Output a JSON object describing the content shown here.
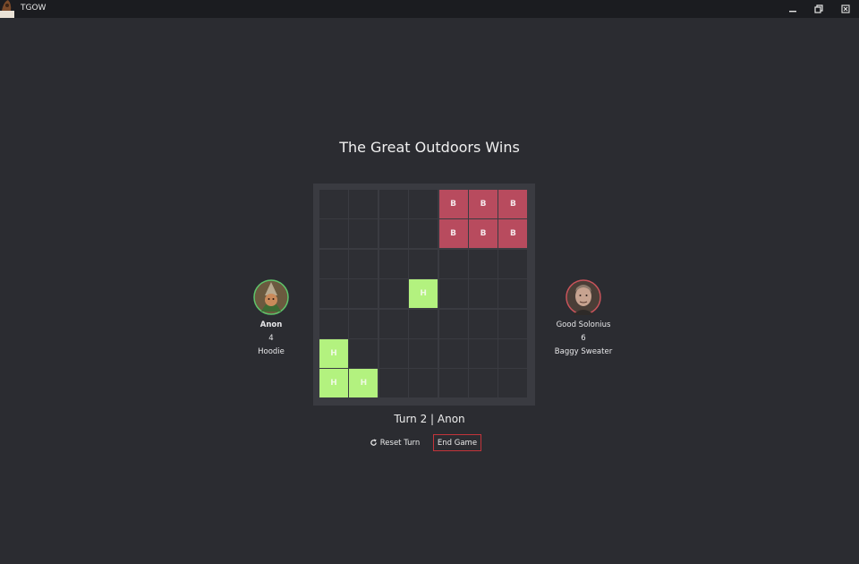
{
  "window": {
    "title": "TGOW"
  },
  "headline": "The Great Outdoors Wins",
  "board": {
    "size": 7,
    "cells": [
      [
        "",
        "",
        "",
        "",
        "B",
        "B",
        "B"
      ],
      [
        "",
        "",
        "",
        "",
        "B",
        "B",
        "B"
      ],
      [
        "",
        "",
        "",
        "",
        "",
        "",
        ""
      ],
      [
        "",
        "",
        "",
        "H",
        "",
        "",
        ""
      ],
      [
        "",
        "",
        "",
        "",
        "",
        "",
        ""
      ],
      [
        "H",
        "",
        "",
        "",
        "",
        "",
        ""
      ],
      [
        "H",
        "H",
        "",
        "",
        "",
        "",
        ""
      ]
    ],
    "colors": {
      "B": "#b84b5e",
      "H": "#b3f27f",
      "empty": "#2e2f34"
    }
  },
  "players": [
    {
      "name": "Anon",
      "score": "4",
      "item": "Hoodie",
      "ring_color": "#5ec46a"
    },
    {
      "name": "Good Solonius",
      "score": "6",
      "item": "Baggy Sweater",
      "ring_color": "#c8535a"
    }
  ],
  "turn_info": "Turn 2 | Anon",
  "buttons": {
    "reset": "Reset Turn",
    "end": "End Game"
  }
}
